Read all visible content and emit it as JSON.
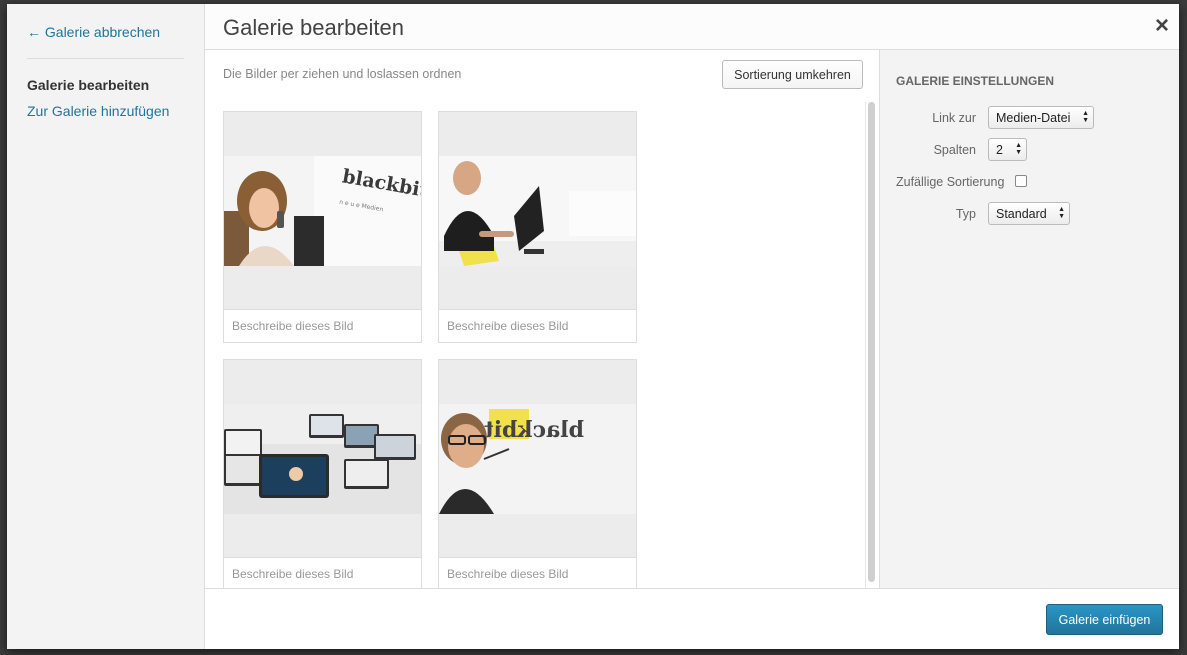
{
  "menu": {
    "cancel_label": "← Galerie abbrechen",
    "active_item": "Galerie bearbeiten",
    "add_item": "Zur Galerie hinzufügen"
  },
  "title": "Galerie bearbeiten",
  "close_glyph": "×",
  "content": {
    "instructions": "Die Bilder per ziehen und loslassen ordnen",
    "reverse_button": "Sortierung umkehren"
  },
  "attachments": [
    {
      "caption_placeholder": "Beschreibe dieses Bild"
    },
    {
      "caption_placeholder": "Beschreibe dieses Bild"
    },
    {
      "caption_placeholder": "Beschreibe dieses Bild"
    },
    {
      "caption_placeholder": "Beschreibe dieses Bild"
    }
  ],
  "settings": {
    "heading": "Galerie Einstellungen",
    "link_label": "Link zur",
    "link_value": "Medien-Datei",
    "columns_label": "Spalten",
    "columns_value": "2",
    "random_label": "Zufällige Sortierung",
    "random_checked": false,
    "type_label": "Typ",
    "type_value": "Standard"
  },
  "toolbar": {
    "insert_button": "Galerie einfügen"
  },
  "colors": {
    "link": "#21759b",
    "primary_button": "#2a95c5"
  }
}
